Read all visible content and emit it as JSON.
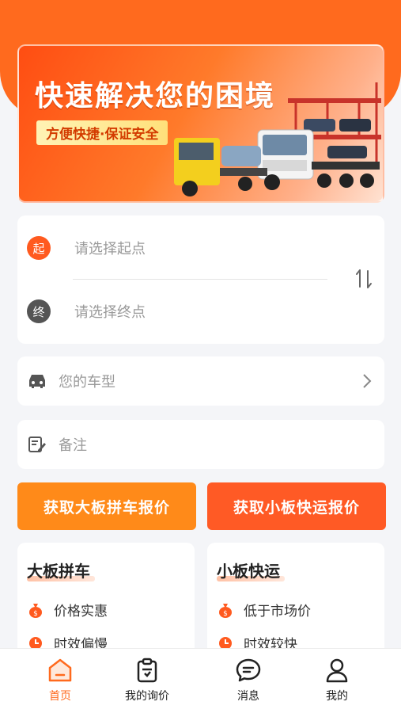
{
  "banner": {
    "title": "快速解决您的困境",
    "subtitle": "方便快捷·保证安全"
  },
  "route": {
    "start_badge": "起",
    "start_placeholder": "请选择起点",
    "end_badge": "终",
    "end_placeholder": "请选择终点"
  },
  "fields": {
    "vehicle_placeholder": "您的车型",
    "note_placeholder": "备注"
  },
  "buttons": {
    "big_quote": "获取大板拼车报价",
    "small_quote": "获取小板快运报价"
  },
  "cards": [
    {
      "title": "大板拼车",
      "items": [
        "价格实惠",
        "时效偏慢"
      ]
    },
    {
      "title": "小板快运",
      "items": [
        "低于市场价",
        "时效较快"
      ]
    }
  ],
  "tabs": [
    {
      "label": "首页",
      "active": true
    },
    {
      "label": "我的询价",
      "active": false
    },
    {
      "label": "消息",
      "active": false
    },
    {
      "label": "我的",
      "active": false
    }
  ],
  "colors": {
    "brand": "#ff6a1e",
    "orange_button": "#ff8a19",
    "red_orange_button": "#ff5a25"
  }
}
